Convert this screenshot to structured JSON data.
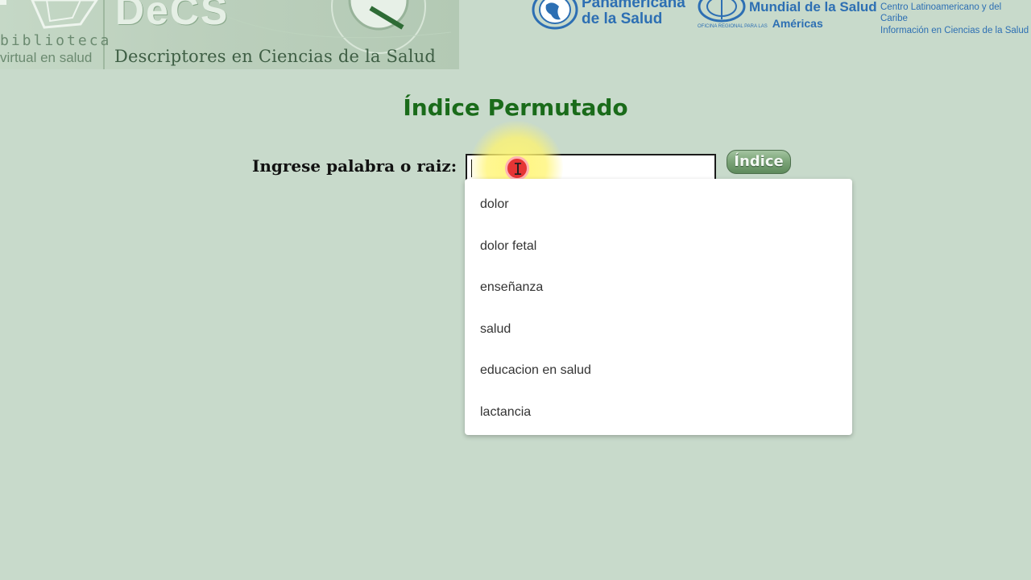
{
  "banner": {
    "bvs_line1": "biblioteca",
    "bvs_line2": "virtual en salud",
    "decs": "DeCS",
    "decs_subtitle": "Descriptores en Ciencias de la Salud"
  },
  "orgs": [
    {
      "lines": [
        "Panamericana",
        "de la Salud"
      ]
    },
    {
      "lines": [
        "Mundial de la Salud",
        "Américas"
      ],
      "prefix": "OFICINA REGIONAL PARA LAS"
    },
    {
      "lines": [
        "Centro Latinoamericano y del Caribe",
        "Información en Ciencias de la Salud"
      ]
    }
  ],
  "page": {
    "title": "Índice Permutado",
    "search_label": "Ingrese palabra o raiz:",
    "search_value": "",
    "button_label": "Índice"
  },
  "suggestions": [
    "dolor",
    "dolor fetal",
    "enseñanza",
    "salud",
    "educacion en salud",
    "lactancia"
  ],
  "colors": {
    "background": "#c8dacb",
    "title": "#1a6b1a",
    "org_blue": "#2d6fb3"
  }
}
